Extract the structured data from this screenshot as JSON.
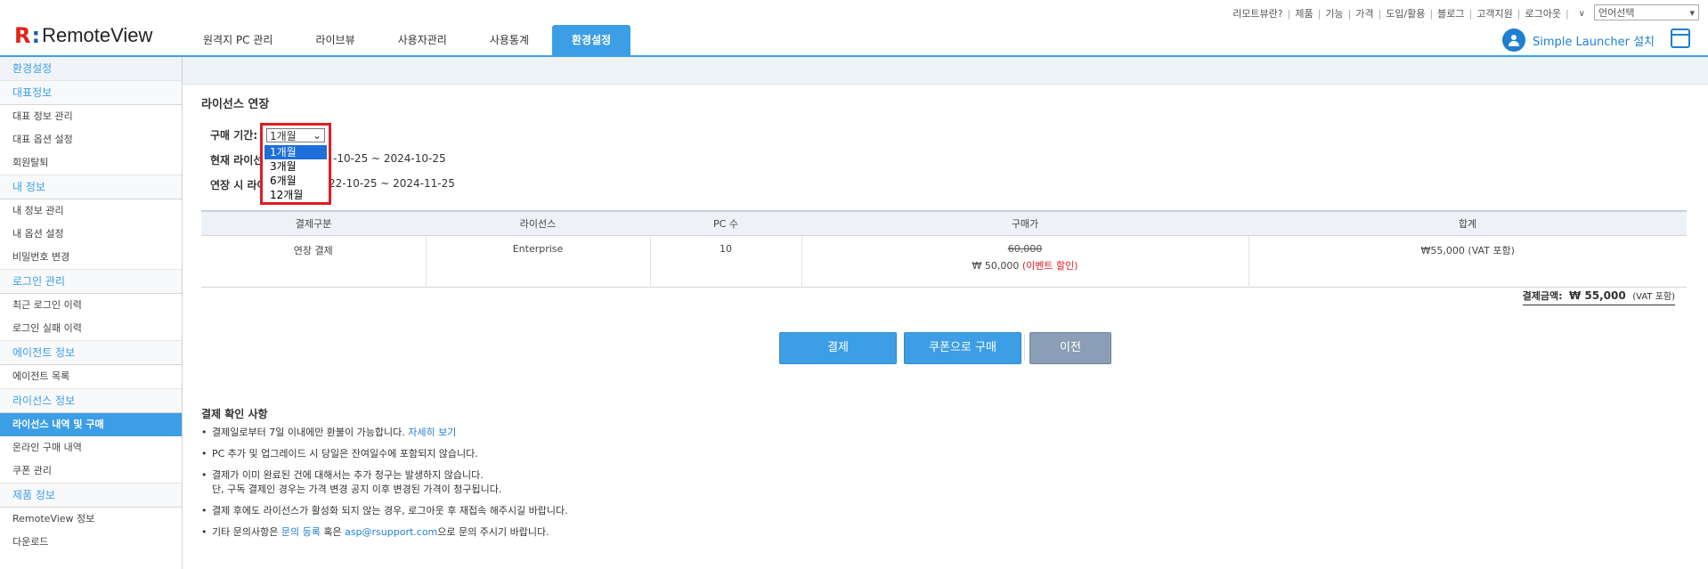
{
  "header": {
    "logo_text": "RemoteView",
    "tabs": [
      {
        "label": "원격지 PC 관리"
      },
      {
        "label": "라이브뷰"
      },
      {
        "label": "사용자관리"
      },
      {
        "label": "사용통계"
      },
      {
        "label": "환경설정"
      }
    ],
    "utility_links": [
      "리모트뷰란?",
      "제품",
      "기능",
      "가격",
      "도입/활용",
      "블로그",
      "고객지원",
      "로그아웃"
    ],
    "language_select": "언어선택",
    "launcher_label": "Simple Launcher 설치"
  },
  "sidebar": {
    "top": "환경설정",
    "groups": [
      {
        "title": "대표정보",
        "items": [
          "대표 정보 관리",
          "대표 옵션 설정",
          "회원탈퇴"
        ]
      },
      {
        "title": "내 정보",
        "items": [
          "내 정보 관리",
          "내 옵션 설정",
          "비밀번호 변경"
        ]
      },
      {
        "title": "로그인 관리",
        "items": [
          "최근 로그인 이력",
          "로그인 실패 이력"
        ]
      },
      {
        "title": "에이전트 정보",
        "items": [
          "에이전트 목록"
        ]
      },
      {
        "title": "라이선스 정보",
        "items": [
          "라이선스 내역 및 구매",
          "온라인 구매 내역",
          "쿠폰 관리"
        ]
      },
      {
        "title": "제품 정보",
        "items": [
          "RemoteView 정보",
          "다운로드"
        ]
      }
    ]
  },
  "main": {
    "section_title": "라이선스 연장",
    "period_label": "구매 기간:",
    "period_selected": "1개월",
    "period_options": [
      "1개월",
      "3개월",
      "6개월",
      "12개월"
    ],
    "current_license_label": "현재 라이선",
    "current_license_value": "-10-25 ~ 2024-10-25",
    "extended_license_label": "연장 시 라이",
    "extended_license_value": "22-10-25 ~ 2024-11-25",
    "table": {
      "headers": [
        "결제구분",
        "라이선스",
        "PC 수",
        "구매가",
        "합계"
      ],
      "row": {
        "type": "연장 결제",
        "license": "Enterprise",
        "pc_count": "10",
        "original_price": "60,000",
        "sale_price": "₩ 50,000",
        "event_note": "(이벤트 할인)",
        "total": "₩55,000 (VAT 포함)"
      }
    },
    "total_label": "결제금액:",
    "total_value": "₩ 55,000",
    "total_vat": "(VAT 포함)",
    "buttons": {
      "pay": "결제",
      "coupon": "쿠폰으로 구매",
      "prev": "이전"
    },
    "notes_title": "결제 확인 사항",
    "notes": {
      "n1_text": "결제일로부터 7일 이내에만 환불이 가능합니다.",
      "n1_link": "자세히 보기",
      "n2": "PC 추가 및 업그레이드 시 당일은 잔여일수에 포함되지 않습니다.",
      "n3_line1": "결제가 이미 완료된 건에 대해서는 추가 청구는 발생하지 않습니다.",
      "n3_line2": "단, 구독 결제인 경우는 가격 변경 공지 이후 변경된 가격이 청구됩니다.",
      "n4": "결제 후에도 라이선스가 활성화 되지 않는 경우, 로그아웃 후 재접속 해주시길 바랍니다.",
      "n5_pre": "기타 문의사항은",
      "n5_link1": "문의 등록",
      "n5_mid": "혹은",
      "n5_link2": "asp@rsupport.com",
      "n5_post": "으로 문의 주시기 바랍니다."
    }
  }
}
